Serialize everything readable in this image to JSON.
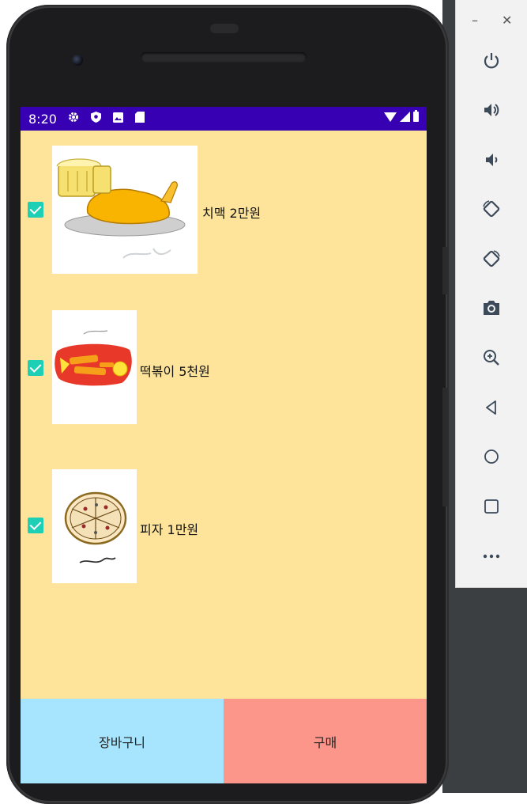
{
  "status_bar": {
    "time": "8:20"
  },
  "items": [
    {
      "label": "치맥 2만원",
      "checked": true
    },
    {
      "label": "떡볶이 5천원",
      "checked": true
    },
    {
      "label": "피자 1만원",
      "checked": true
    }
  ],
  "buttons": {
    "cart": "장바구니",
    "buy": "구매"
  },
  "toolbar": {
    "minimize_symbol": "–",
    "close_symbol": "✕",
    "icons": [
      "power-icon",
      "volume-up-icon",
      "volume-down-icon",
      "rotate-left-icon",
      "rotate-right-icon",
      "camera-icon",
      "zoom-icon",
      "back-icon",
      "home-icon",
      "overview-icon",
      "more-icon"
    ]
  },
  "colors": {
    "status_bar": "#3700b3",
    "screen_bg": "#fde49a",
    "checkbox": "#1dcfb4",
    "cart_button": "#a7e5fe",
    "buy_button": "#fc968b"
  }
}
